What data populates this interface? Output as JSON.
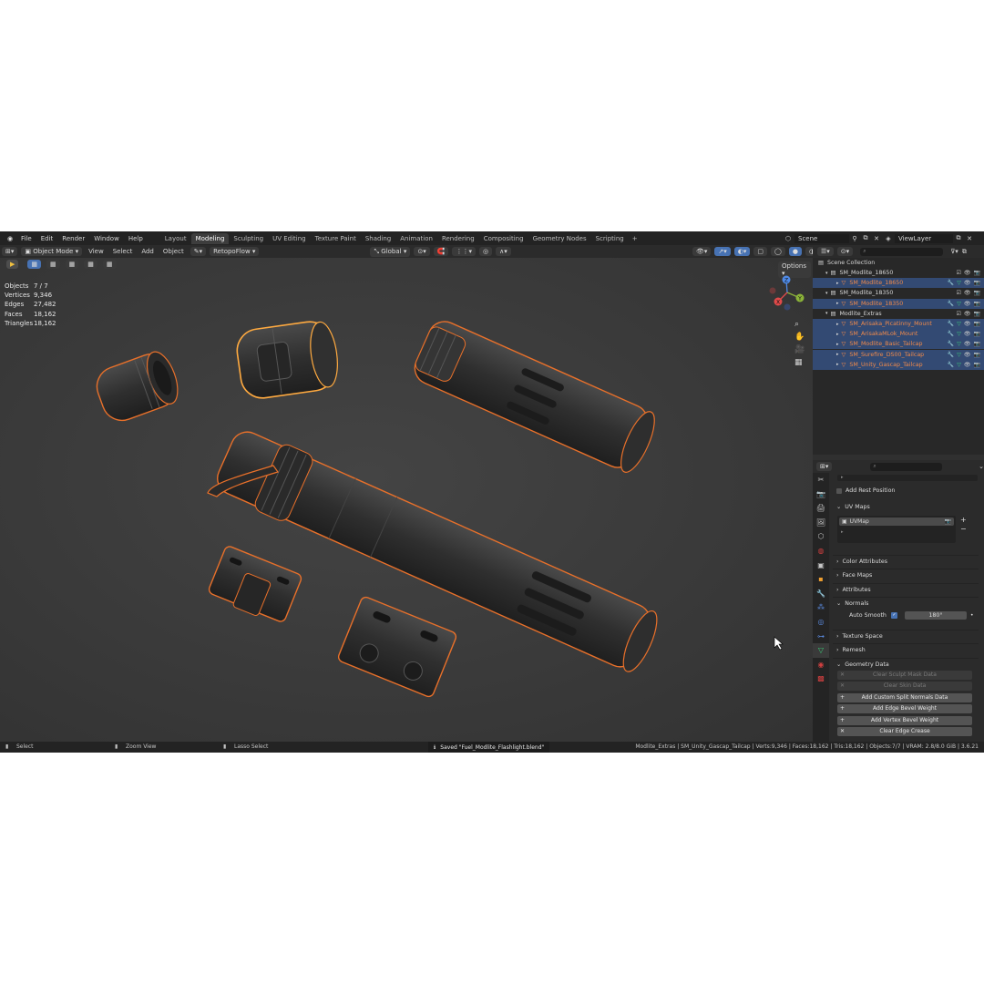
{
  "menu": [
    "File",
    "Edit",
    "Render",
    "Window",
    "Help"
  ],
  "workspaces": [
    "Layout",
    "Modeling",
    "Sculpting",
    "UV Editing",
    "Texture Paint",
    "Shading",
    "Animation",
    "Rendering",
    "Compositing",
    "Geometry Nodes",
    "Scripting"
  ],
  "active_workspace": "Modeling",
  "add_workspace": "+",
  "scene": "Scene",
  "view_layer": "ViewLayer",
  "header": {
    "mode": "Object Mode",
    "view": "View",
    "select": "Select",
    "add": "Add",
    "object": "Object",
    "retopo": "RetopoFlow",
    "transform": "Global",
    "options": "Options"
  },
  "stats": [
    {
      "label": "Objects",
      "value": "7 / 7"
    },
    {
      "label": "Vertices",
      "value": "9,346"
    },
    {
      "label": "Edges",
      "value": "27,482"
    },
    {
      "label": "Faces",
      "value": "18,162"
    },
    {
      "label": "Triangles",
      "value": "18,162"
    }
  ],
  "gizmo": {
    "x": "X",
    "y": "Y",
    "z": "Z"
  },
  "outliner": {
    "root": "Scene Collection",
    "items": [
      {
        "name": "SM_Modlite_18650",
        "type": "collection",
        "selected": false
      },
      {
        "name": "SM_Modlite_18650",
        "type": "mesh",
        "selected": true
      },
      {
        "name": "SM_Modlite_18350",
        "type": "collection",
        "selected": false
      },
      {
        "name": "SM_Modlite_18350",
        "type": "mesh",
        "selected": true
      },
      {
        "name": "Modlite_Extras",
        "type": "collection",
        "selected": false
      },
      {
        "name": "SM_Arisaka_Picatinny_Mount",
        "type": "mesh",
        "selected": true
      },
      {
        "name": "SM_ArisakaMLok_Mount",
        "type": "mesh",
        "selected": true
      },
      {
        "name": "SM_Modlite_Basic_Tailcap",
        "type": "mesh",
        "selected": true
      },
      {
        "name": "SM_Surefire_DS00_Tailcap",
        "type": "mesh",
        "selected": true
      },
      {
        "name": "SM_Unity_Gascap_Tailcap",
        "type": "mesh",
        "selected": true
      }
    ]
  },
  "properties": {
    "add_rest_position": "Add Rest Position",
    "uv_maps": "UV Maps",
    "uv_map_name": "UVMap",
    "sections": [
      "Color Attributes",
      "Face Maps",
      "Attributes",
      "Normals"
    ],
    "auto_smooth": "Auto Smooth",
    "auto_smooth_angle": "180°",
    "sections2": [
      "Texture Space",
      "Remesh",
      "Geometry Data"
    ],
    "ops": [
      {
        "label": "Clear Sculpt Mask Data",
        "enabled": false
      },
      {
        "label": "Clear Skin Data",
        "enabled": false
      },
      {
        "label": "Add Custom Split Normals Data",
        "enabled": true
      },
      {
        "label": "Add Edge Bevel Weight",
        "enabled": true
      },
      {
        "label": "Add Vertex Bevel Weight",
        "enabled": true
      },
      {
        "label": "Clear Edge Crease",
        "enabled": true
      }
    ]
  },
  "status": {
    "select": "Select",
    "zoom": "Zoom View",
    "lasso": "Lasso Select",
    "saved": "Saved \"Fuel_Modlite_Flashlight.blend\"",
    "info": "Modlite_Extras | SM_Unity_Gascap_Tailcap | Verts:9,346 | Faces:18,162 | Tris:18,162 | Objects:7/7 | VRAM: 2.8/8.0 GiB | 3.6.21"
  },
  "colors": {
    "accent": "#4772b3",
    "outline": "#e8702a",
    "active_outline": "#ffaa40",
    "selected_row": "#334a73"
  }
}
